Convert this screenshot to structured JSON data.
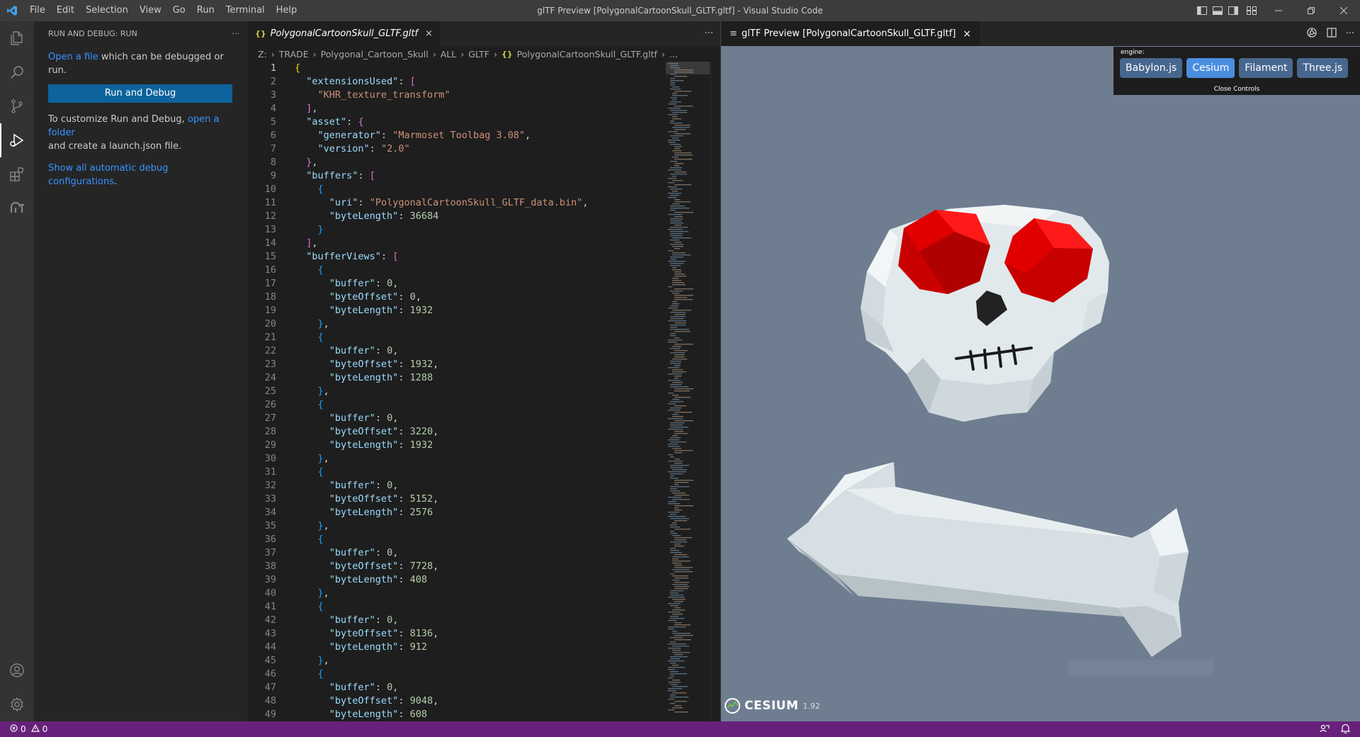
{
  "window": {
    "title": "glTF Preview [PolygonalCartoonSkull_GLTF.gltf] - Visual Studio Code",
    "menu": [
      "File",
      "Edit",
      "Selection",
      "View",
      "Go",
      "Run",
      "Terminal",
      "Help"
    ]
  },
  "activity_bar": {
    "items": [
      "files-icon",
      "search-icon",
      "source-control-icon",
      "run-debug-icon",
      "extensions-icon",
      "gltf-icon"
    ],
    "bottom": [
      "account-icon",
      "settings-gear-icon"
    ]
  },
  "sidebar": {
    "header": "RUN AND DEBUG: RUN",
    "more": "···",
    "open_file_link": "Open a file",
    "open_file_rest": " which can be debugged or run.",
    "run_button": "Run and Debug",
    "customize_pre": "To customize Run and Debug, ",
    "open_folder_link": "open a folder",
    "customize_post": "and create a launch.json file.",
    "show_all_link": "Show all automatic debug configurations",
    "show_all_rest": "."
  },
  "editor": {
    "tab_icon": "{}",
    "tab_label": "PolygonalCartoonSkull_GLTF.gltf",
    "tab_close": "×",
    "more": "···",
    "breadcrumb": [
      "Z:",
      "TRADE",
      "Polygonal_Cartoon_Skull",
      "ALL",
      "GLTF"
    ],
    "breadcrumb_file_icon": "{}",
    "breadcrumb_file": "PolygonalCartoonSkull_GLTF.gltf",
    "breadcrumb_tail": "...",
    "current_line": 1,
    "lines": [
      [
        [
          "b1",
          "{"
        ]
      ],
      [
        [
          "p",
          "  "
        ],
        [
          "k",
          "\"extensionsUsed\""
        ],
        [
          "p",
          ": "
        ],
        [
          "b2",
          "["
        ]
      ],
      [
        [
          "p",
          "    "
        ],
        [
          "s",
          "\"KHR_texture_transform\""
        ]
      ],
      [
        [
          "p",
          "  "
        ],
        [
          "b2",
          "]"
        ],
        [
          "p",
          ","
        ]
      ],
      [
        [
          "p",
          "  "
        ],
        [
          "k",
          "\"asset\""
        ],
        [
          "p",
          ": "
        ],
        [
          "b2",
          "{"
        ]
      ],
      [
        [
          "p",
          "    "
        ],
        [
          "k",
          "\"generator\""
        ],
        [
          "p",
          ": "
        ],
        [
          "s",
          "\"Marmoset Toolbag 3.08\""
        ],
        [
          "p",
          ","
        ]
      ],
      [
        [
          "p",
          "    "
        ],
        [
          "k",
          "\"version\""
        ],
        [
          "p",
          ": "
        ],
        [
          "s",
          "\"2.0\""
        ]
      ],
      [
        [
          "p",
          "  "
        ],
        [
          "b2",
          "}"
        ],
        [
          "p",
          ","
        ]
      ],
      [
        [
          "p",
          "  "
        ],
        [
          "k",
          "\"buffers\""
        ],
        [
          "p",
          ": "
        ],
        [
          "b2",
          "["
        ]
      ],
      [
        [
          "p",
          "    "
        ],
        [
          "b3",
          "{"
        ]
      ],
      [
        [
          "p",
          "      "
        ],
        [
          "k",
          "\"uri\""
        ],
        [
          "p",
          ": "
        ],
        [
          "s",
          "\"PolygonalCartoonSkull_GLTF_data.bin\""
        ],
        [
          "p",
          ","
        ]
      ],
      [
        [
          "p",
          "      "
        ],
        [
          "k",
          "\"byteLength\""
        ],
        [
          "p",
          ": "
        ],
        [
          "n",
          "36684"
        ]
      ],
      [
        [
          "p",
          "    "
        ],
        [
          "b3",
          "}"
        ]
      ],
      [
        [
          "p",
          "  "
        ],
        [
          "b2",
          "]"
        ],
        [
          "p",
          ","
        ]
      ],
      [
        [
          "p",
          "  "
        ],
        [
          "k",
          "\"bufferViews\""
        ],
        [
          "p",
          ": "
        ],
        [
          "b2",
          "["
        ]
      ],
      [
        [
          "p",
          "    "
        ],
        [
          "b3",
          "{"
        ]
      ],
      [
        [
          "p",
          "      "
        ],
        [
          "k",
          "\"buffer\""
        ],
        [
          "p",
          ": "
        ],
        [
          "n",
          "0"
        ],
        [
          "p",
          ","
        ]
      ],
      [
        [
          "p",
          "      "
        ],
        [
          "k",
          "\"byteOffset\""
        ],
        [
          "p",
          ": "
        ],
        [
          "n",
          "0"
        ],
        [
          "p",
          ","
        ]
      ],
      [
        [
          "p",
          "      "
        ],
        [
          "k",
          "\"byteLength\""
        ],
        [
          "p",
          ": "
        ],
        [
          "n",
          "1932"
        ]
      ],
      [
        [
          "p",
          "    "
        ],
        [
          "b3",
          "}"
        ],
        [
          "p",
          ","
        ]
      ],
      [
        [
          "p",
          "    "
        ],
        [
          "b3",
          "{"
        ]
      ],
      [
        [
          "p",
          "      "
        ],
        [
          "k",
          "\"buffer\""
        ],
        [
          "p",
          ": "
        ],
        [
          "n",
          "0"
        ],
        [
          "p",
          ","
        ]
      ],
      [
        [
          "p",
          "      "
        ],
        [
          "k",
          "\"byteOffset\""
        ],
        [
          "p",
          ": "
        ],
        [
          "n",
          "1932"
        ],
        [
          "p",
          ","
        ]
      ],
      [
        [
          "p",
          "      "
        ],
        [
          "k",
          "\"byteLength\""
        ],
        [
          "p",
          ": "
        ],
        [
          "n",
          "1288"
        ]
      ],
      [
        [
          "p",
          "    "
        ],
        [
          "b3",
          "}"
        ],
        [
          "p",
          ","
        ]
      ],
      [
        [
          "p",
          "    "
        ],
        [
          "b3",
          "{"
        ]
      ],
      [
        [
          "p",
          "      "
        ],
        [
          "k",
          "\"buffer\""
        ],
        [
          "p",
          ": "
        ],
        [
          "n",
          "0"
        ],
        [
          "p",
          ","
        ]
      ],
      [
        [
          "p",
          "      "
        ],
        [
          "k",
          "\"byteOffset\""
        ],
        [
          "p",
          ": "
        ],
        [
          "n",
          "3220"
        ],
        [
          "p",
          ","
        ]
      ],
      [
        [
          "p",
          "      "
        ],
        [
          "k",
          "\"byteLength\""
        ],
        [
          "p",
          ": "
        ],
        [
          "n",
          "1932"
        ]
      ],
      [
        [
          "p",
          "    "
        ],
        [
          "b3",
          "}"
        ],
        [
          "p",
          ","
        ]
      ],
      [
        [
          "p",
          "    "
        ],
        [
          "b3",
          "{"
        ]
      ],
      [
        [
          "p",
          "      "
        ],
        [
          "k",
          "\"buffer\""
        ],
        [
          "p",
          ": "
        ],
        [
          "n",
          "0"
        ],
        [
          "p",
          ","
        ]
      ],
      [
        [
          "p",
          "      "
        ],
        [
          "k",
          "\"byteOffset\""
        ],
        [
          "p",
          ": "
        ],
        [
          "n",
          "5152"
        ],
        [
          "p",
          ","
        ]
      ],
      [
        [
          "p",
          "      "
        ],
        [
          "k",
          "\"byteLength\""
        ],
        [
          "p",
          ": "
        ],
        [
          "n",
          "2576"
        ]
      ],
      [
        [
          "p",
          "    "
        ],
        [
          "b3",
          "}"
        ],
        [
          "p",
          ","
        ]
      ],
      [
        [
          "p",
          "    "
        ],
        [
          "b3",
          "{"
        ]
      ],
      [
        [
          "p",
          "      "
        ],
        [
          "k",
          "\"buffer\""
        ],
        [
          "p",
          ": "
        ],
        [
          "n",
          "0"
        ],
        [
          "p",
          ","
        ]
      ],
      [
        [
          "p",
          "      "
        ],
        [
          "k",
          "\"byteOffset\""
        ],
        [
          "p",
          ": "
        ],
        [
          "n",
          "7728"
        ],
        [
          "p",
          ","
        ]
      ],
      [
        [
          "p",
          "      "
        ],
        [
          "k",
          "\"byteLength\""
        ],
        [
          "p",
          ": "
        ],
        [
          "n",
          "408"
        ]
      ],
      [
        [
          "p",
          "    "
        ],
        [
          "b3",
          "}"
        ],
        [
          "p",
          ","
        ]
      ],
      [
        [
          "p",
          "    "
        ],
        [
          "b3",
          "{"
        ]
      ],
      [
        [
          "p",
          "      "
        ],
        [
          "k",
          "\"buffer\""
        ],
        [
          "p",
          ": "
        ],
        [
          "n",
          "0"
        ],
        [
          "p",
          ","
        ]
      ],
      [
        [
          "p",
          "      "
        ],
        [
          "k",
          "\"byteOffset\""
        ],
        [
          "p",
          ": "
        ],
        [
          "n",
          "8136"
        ],
        [
          "p",
          ","
        ]
      ],
      [
        [
          "p",
          "      "
        ],
        [
          "k",
          "\"byteLength\""
        ],
        [
          "p",
          ": "
        ],
        [
          "n",
          "912"
        ]
      ],
      [
        [
          "p",
          "    "
        ],
        [
          "b3",
          "}"
        ],
        [
          "p",
          ","
        ]
      ],
      [
        [
          "p",
          "    "
        ],
        [
          "b3",
          "{"
        ]
      ],
      [
        [
          "p",
          "      "
        ],
        [
          "k",
          "\"buffer\""
        ],
        [
          "p",
          ": "
        ],
        [
          "n",
          "0"
        ],
        [
          "p",
          ","
        ]
      ],
      [
        [
          "p",
          "      "
        ],
        [
          "k",
          "\"byteOffset\""
        ],
        [
          "p",
          ": "
        ],
        [
          "n",
          "9048"
        ],
        [
          "p",
          ","
        ]
      ],
      [
        [
          "p",
          "      "
        ],
        [
          "k",
          "\"byteLength\""
        ],
        [
          "p",
          ": "
        ],
        [
          "n",
          "608"
        ]
      ]
    ]
  },
  "preview": {
    "tab_icon": "≡",
    "tab_label": "glTF Preview [PolygonalCartoonSkull_GLTF.gltf]",
    "tab_close": "×",
    "engine_label": "engine:",
    "engines": [
      "Babylon.js",
      "Cesium",
      "Filament",
      "Three.js"
    ],
    "selected_engine": "Cesium",
    "close_controls": "Close Controls",
    "cesium_word": "CESIUM",
    "cesium_version": "1.92"
  },
  "status_bar": {
    "errors": "0",
    "warnings": "0"
  },
  "colors": {
    "accent": "#0e639c",
    "status_bar": "#68217a",
    "viewport_bg": "#6f7d90",
    "skull": "#dfe6ea",
    "eyes": "#e00000"
  }
}
